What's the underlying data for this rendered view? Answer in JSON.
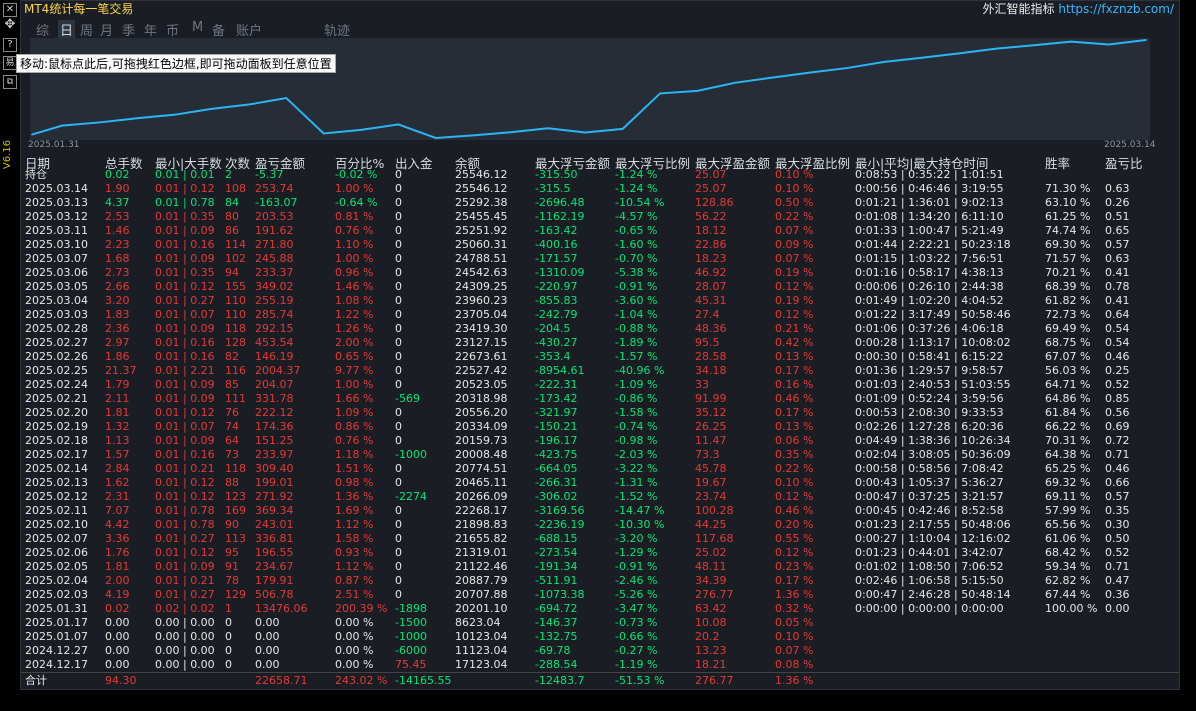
{
  "window": {
    "title": "MT4统计每一笔交易",
    "brand_name": "外汇智能指标",
    "brand_url": "https://fxznzb.com/",
    "version": "V6.16"
  },
  "toolbar_icons": [
    "close-icon",
    "move-icon",
    "help-icon",
    "indicator-icon",
    "copy-icon"
  ],
  "tabs": [
    "综",
    "日",
    "周",
    "月",
    "季",
    "年",
    "币",
    "M",
    "备",
    "账户",
    "轨迹"
  ],
  "active_tab": "日",
  "tooltip": "移动:鼠标点此后,可拖拽红色边框,即可拖动面板到任意位置",
  "chart": {
    "start_date": "2025.01.31",
    "end_date": "2025.03.14",
    "line_color": "#29b6f6"
  },
  "chart_data": {
    "type": "line",
    "x": [
      "2025.01.31",
      "2025.02.03",
      "2025.02.04",
      "2025.02.05",
      "2025.02.06",
      "2025.02.07",
      "2025.02.10",
      "2025.02.11",
      "2025.02.12",
      "2025.02.13",
      "2025.02.14",
      "2025.02.17",
      "2025.02.18",
      "2025.02.19",
      "2025.02.20",
      "2025.02.21",
      "2025.02.24",
      "2025.02.25",
      "2025.02.26",
      "2025.02.27",
      "2025.02.28",
      "2025.03.03",
      "2025.03.04",
      "2025.03.05",
      "2025.03.06",
      "2025.03.07",
      "2025.03.10",
      "2025.03.11",
      "2025.03.12",
      "2025.03.13",
      "2025.03.14"
    ],
    "values": [
      20201.1,
      20707.88,
      20887.79,
      21122.46,
      21319.01,
      21655.82,
      21898.83,
      22268.17,
      20266.09,
      20465.11,
      20774.51,
      20008.48,
      20159.73,
      20334.09,
      20556.2,
      20318.98,
      20523.05,
      22527.42,
      22673.61,
      23127.15,
      23419.3,
      23705.04,
      23960.23,
      24309.25,
      24542.63,
      24788.51,
      25060.31,
      25251.92,
      25455.45,
      25292.38,
      25546.12
    ]
  },
  "columns": [
    "日期",
    "总手数",
    "最小|大手数",
    "次数",
    "盈亏金额",
    "百分比%",
    "出入金",
    "余额",
    "最大浮亏金额",
    "最大浮亏比例",
    "最大浮盈金额",
    "最大浮盈比例",
    "最小|平均|最大持仓时间",
    "胜率",
    "盈亏比"
  ],
  "holding": [
    "持仓",
    "0.02",
    "0.01 | 0.01",
    "2",
    "-5.37",
    "-0.02 %",
    "0",
    "25546.12",
    "-315.50",
    "-1.24 %",
    "25.07",
    "0.10 %",
    "0:08:53 | 0:35:22 | 1:01:51",
    "",
    ""
  ],
  "rows": [
    [
      "2025.03.14",
      "1.90",
      "0.01 | 0.12",
      "108",
      "253.74",
      "1.00 %",
      "0",
      "25546.12",
      "-315.5",
      "-1.24 %",
      "25.07",
      "0.10 %",
      "0:00:56 | 0:46:46 | 3:19:55",
      "71.30 %",
      "0.63"
    ],
    [
      "2025.03.13",
      "4.37",
      "0.01 | 0.78",
      "84",
      "-163.07",
      "-0.64 %",
      "0",
      "25292.38",
      "-2696.48",
      "-10.54 %",
      "128.86",
      "0.50 %",
      "0:01:21 | 1:36:01 | 9:02:13",
      "63.10 %",
      "0.26"
    ],
    [
      "2025.03.12",
      "2.53",
      "0.01 | 0.35",
      "80",
      "203.53",
      "0.81 %",
      "0",
      "25455.45",
      "-1162.19",
      "-4.57 %",
      "56.22",
      "0.22 %",
      "0:01:08 | 1:34:20 | 6:11:10",
      "61.25 %",
      "0.51"
    ],
    [
      "2025.03.11",
      "1.46",
      "0.01 | 0.09",
      "86",
      "191.62",
      "0.76 %",
      "0",
      "25251.92",
      "-163.42",
      "-0.65 %",
      "18.12",
      "0.07 %",
      "0:01:33 | 1:00:47 | 5:21:49",
      "74.74 %",
      "0.65"
    ],
    [
      "2025.03.10",
      "2.23",
      "0.01 | 0.16",
      "114",
      "271.80",
      "1.10 %",
      "0",
      "25060.31",
      "-400.16",
      "-1.60 %",
      "22.86",
      "0.09 %",
      "0:01:44 | 2:22:21 | 50:23:18",
      "69.30 %",
      "0.57"
    ],
    [
      "2025.03.07",
      "1.68",
      "0.01 | 0.09",
      "102",
      "245.88",
      "1.00 %",
      "0",
      "24788.51",
      "-171.57",
      "-0.70 %",
      "18.23",
      "0.07 %",
      "0:01:15 | 1:03:22 | 7:56:51",
      "71.57 %",
      "0.63"
    ],
    [
      "2025.03.06",
      "2.73",
      "0.01 | 0.35",
      "94",
      "233.37",
      "0.96 %",
      "0",
      "24542.63",
      "-1310.09",
      "-5.38 %",
      "46.92",
      "0.19 %",
      "0:01:16 | 0:58:17 | 4:38:13",
      "70.21 %",
      "0.41"
    ],
    [
      "2025.03.05",
      "2.66",
      "0.01 | 0.12",
      "155",
      "349.02",
      "1.46 %",
      "0",
      "24309.25",
      "-220.97",
      "-0.91 %",
      "28.07",
      "0.12 %",
      "0:00:06 | 0:26:10 | 2:44:38",
      "68.39 %",
      "0.78"
    ],
    [
      "2025.03.04",
      "3.20",
      "0.01 | 0.27",
      "110",
      "255.19",
      "1.08 %",
      "0",
      "23960.23",
      "-855.83",
      "-3.60 %",
      "45.31",
      "0.19 %",
      "0:01:49 | 1:02:20 | 4:04:52",
      "61.82 %",
      "0.41"
    ],
    [
      "2025.03.03",
      "1.83",
      "0.01 | 0.07",
      "110",
      "285.74",
      "1.22 %",
      "0",
      "23705.04",
      "-242.79",
      "-1.04 %",
      "27.4",
      "0.12 %",
      "0:01:22 | 3:17:49 | 50:58:46",
      "72.73 %",
      "0.64"
    ],
    [
      "2025.02.28",
      "2.36",
      "0.01 | 0.09",
      "118",
      "292.15",
      "1.26 %",
      "0",
      "23419.30",
      "-204.5",
      "-0.88 %",
      "48.36",
      "0.21 %",
      "0:01:06 | 0:37:26 | 4:06:18",
      "69.49 %",
      "0.54"
    ],
    [
      "2025.02.27",
      "2.97",
      "0.01 | 0.16",
      "128",
      "453.54",
      "2.00 %",
      "0",
      "23127.15",
      "-430.27",
      "-1.89 %",
      "95.5",
      "0.42 %",
      "0:00:28 | 1:13:17 | 10:08:02",
      "68.75 %",
      "0.54"
    ],
    [
      "2025.02.26",
      "1.86",
      "0.01 | 0.16",
      "82",
      "146.19",
      "0.65 %",
      "0",
      "22673.61",
      "-353.4",
      "-1.57 %",
      "28.58",
      "0.13 %",
      "0:00:30 | 0:58:41 | 6:15:22",
      "67.07 %",
      "0.46"
    ],
    [
      "2025.02.25",
      "21.37",
      "0.01 | 2.21",
      "116",
      "2004.37",
      "9.77 %",
      "0",
      "22527.42",
      "-8954.61",
      "-40.96 %",
      "34.18",
      "0.17 %",
      "0:01:36 | 1:29:57 | 9:58:57",
      "56.03 %",
      "0.25"
    ],
    [
      "2025.02.24",
      "1.79",
      "0.01 | 0.09",
      "85",
      "204.07",
      "1.00 %",
      "0",
      "20523.05",
      "-222.31",
      "-1.09 %",
      "33",
      "0.16 %",
      "0:01:03 | 2:40:53 | 51:03:55",
      "64.71 %",
      "0.52"
    ],
    [
      "2025.02.21",
      "2.11",
      "0.01 | 0.09",
      "111",
      "331.78",
      "1.66 %",
      "-569",
      "20318.98",
      "-173.42",
      "-0.86 %",
      "91.99",
      "0.46 %",
      "0:01:09 | 0:52:24 | 3:59:56",
      "64.86 %",
      "0.85"
    ],
    [
      "2025.02.20",
      "1.81",
      "0.01 | 0.12",
      "76",
      "222.12",
      "1.09 %",
      "0",
      "20556.20",
      "-321.97",
      "-1.58 %",
      "35.12",
      "0.17 %",
      "0:00:53 | 2:08:30 | 9:33:53",
      "61.84 %",
      "0.56"
    ],
    [
      "2025.02.19",
      "1.32",
      "0.01 | 0.07",
      "74",
      "174.36",
      "0.86 %",
      "0",
      "20334.09",
      "-150.21",
      "-0.74 %",
      "26.25",
      "0.13 %",
      "0:02:26 | 1:27:28 | 6:20:36",
      "66.22 %",
      "0.69"
    ],
    [
      "2025.02.18",
      "1.13",
      "0.01 | 0.09",
      "64",
      "151.25",
      "0.76 %",
      "0",
      "20159.73",
      "-196.17",
      "-0.98 %",
      "11.47",
      "0.06 %",
      "0:04:49 | 1:38:36 | 10:26:34",
      "70.31 %",
      "0.72"
    ],
    [
      "2025.02.17",
      "1.57",
      "0.01 | 0.16",
      "73",
      "233.97",
      "1.18 %",
      "-1000",
      "20008.48",
      "-423.75",
      "-2.03 %",
      "73.3",
      "0.35 %",
      "0:02:04 | 3:08:05 | 50:36:09",
      "64.38 %",
      "0.71"
    ],
    [
      "2025.02.14",
      "2.84",
      "0.01 | 0.21",
      "118",
      "309.40",
      "1.51 %",
      "0",
      "20774.51",
      "-664.05",
      "-3.22 %",
      "45.78",
      "0.22 %",
      "0:00:58 | 0:58:56 | 7:08:42",
      "65.25 %",
      "0.46"
    ],
    [
      "2025.02.13",
      "1.62",
      "0.01 | 0.12",
      "88",
      "199.01",
      "0.98 %",
      "0",
      "20465.11",
      "-266.31",
      "-1.31 %",
      "19.67",
      "0.10 %",
      "0:00:43 | 1:05:37 | 5:36:27",
      "69.32 %",
      "0.66"
    ],
    [
      "2025.02.12",
      "2.31",
      "0.01 | 0.12",
      "123",
      "271.92",
      "1.36 %",
      "-2274",
      "20266.09",
      "-306.02",
      "-1.52 %",
      "23.74",
      "0.12 %",
      "0:00:47 | 0:37:25 | 3:21:57",
      "69.11 %",
      "0.57"
    ],
    [
      "2025.02.11",
      "7.07",
      "0.01 | 0.78",
      "169",
      "369.34",
      "1.69 %",
      "0",
      "22268.17",
      "-3169.56",
      "-14.47 %",
      "100.28",
      "0.46 %",
      "0:00:45 | 0:42:46 | 8:52:58",
      "57.99 %",
      "0.35"
    ],
    [
      "2025.02.10",
      "4.42",
      "0.01 | 0.78",
      "90",
      "243.01",
      "1.12 %",
      "0",
      "21898.83",
      "-2236.19",
      "-10.30 %",
      "44.25",
      "0.20 %",
      "0:01:23 | 2:17:55 | 50:48:06",
      "65.56 %",
      "0.30"
    ],
    [
      "2025.02.07",
      "3.36",
      "0.01 | 0.27",
      "113",
      "336.81",
      "1.58 %",
      "0",
      "21655.82",
      "-688.15",
      "-3.20 %",
      "117.68",
      "0.55 %",
      "0:00:27 | 1:10:04 | 12:16:02",
      "61.06 %",
      "0.50"
    ],
    [
      "2025.02.06",
      "1.76",
      "0.01 | 0.12",
      "95",
      "196.55",
      "0.93 %",
      "0",
      "21319.01",
      "-273.54",
      "-1.29 %",
      "25.02",
      "0.12 %",
      "0:01:23 | 0:44:01 | 3:42:07",
      "68.42 %",
      "0.52"
    ],
    [
      "2025.02.05",
      "1.81",
      "0.01 | 0.09",
      "91",
      "234.67",
      "1.12 %",
      "0",
      "21122.46",
      "-191.34",
      "-0.91 %",
      "48.11",
      "0.23 %",
      "0:01:02 | 1:08:50 | 7:06:52",
      "59.34 %",
      "0.71"
    ],
    [
      "2025.02.04",
      "2.00",
      "0.01 | 0.21",
      "78",
      "179.91",
      "0.87 %",
      "0",
      "20887.79",
      "-511.91",
      "-2.46 %",
      "34.39",
      "0.17 %",
      "0:02:46 | 1:06:58 | 5:15:50",
      "62.82 %",
      "0.47"
    ],
    [
      "2025.02.03",
      "4.19",
      "0.01 | 0.27",
      "129",
      "506.78",
      "2.51 %",
      "0",
      "20707.88",
      "-1073.38",
      "-5.26 %",
      "276.77",
      "1.36 %",
      "0:00:47 | 2:46:28 | 50:48:14",
      "67.44 %",
      "0.36"
    ],
    [
      "2025.01.31",
      "0.02",
      "0.02 | 0.02",
      "1",
      "13476.06",
      "200.39 %",
      "-1898",
      "20201.10",
      "-694.72",
      "-3.47 %",
      "63.42",
      "0.32 %",
      "0:00:00 | 0:00:00 | 0:00:00",
      "100.00 %",
      "0.00"
    ],
    [
      "2025.01.17",
      "0.00",
      "0.00 | 0.00",
      "0",
      "0.00",
      "0.00 %",
      "-1500",
      "8623.04",
      "-146.37",
      "-0.73 %",
      "10.08",
      "0.05 %",
      "",
      "",
      ""
    ],
    [
      "2025.01.07",
      "0.00",
      "0.00 | 0.00",
      "0",
      "0.00",
      "0.00 %",
      "-1000",
      "10123.04",
      "-132.75",
      "-0.66 %",
      "20.2",
      "0.10 %",
      "",
      "",
      ""
    ],
    [
      "2024.12.27",
      "0.00",
      "0.00 | 0.00",
      "0",
      "0.00",
      "0.00 %",
      "-6000",
      "11123.04",
      "-69.78",
      "-0.27 %",
      "13.23",
      "0.07 %",
      "",
      "",
      ""
    ],
    [
      "2024.12.17",
      "0.00",
      "0.00 | 0.00",
      "0",
      "0.00",
      "0.00 %",
      "75.45",
      "17123.04",
      "-288.54",
      "-1.19 %",
      "18.21",
      "0.08 %",
      "",
      "",
      ""
    ]
  ],
  "total": [
    "合计",
    "94.30",
    "",
    "",
    "22658.71",
    "243.02 %",
    "-14165.55",
    "",
    "-12483.7",
    "-51.53 %",
    "276.77",
    "1.36 %",
    "",
    "",
    ""
  ],
  "colors": {
    "profit": "#e53935",
    "loss": "#00e676",
    "neutral": "#e6e6e6",
    "accent": "#ffd54a"
  }
}
